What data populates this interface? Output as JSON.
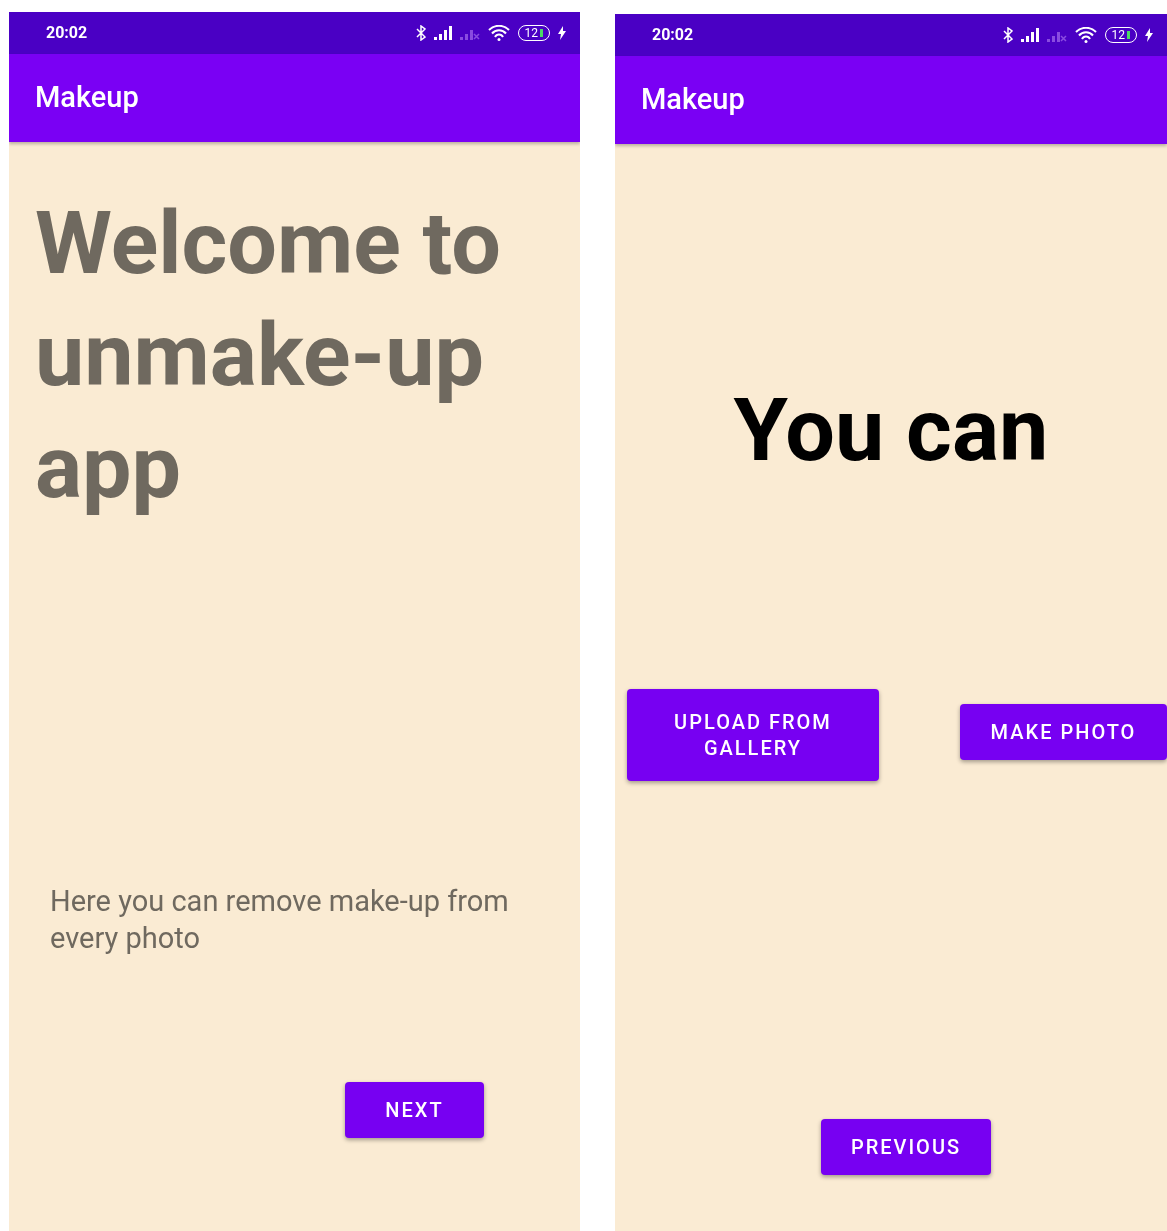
{
  "screens": [
    {
      "kind": "welcome",
      "status_bar": {
        "time": "20:02",
        "battery": "12"
      },
      "app_bar": {
        "title": "Makeup"
      },
      "heading": "Welcome to unmake-up app",
      "description": "Here you can remove make-up from every photo",
      "buttons": [
        "NEXT"
      ]
    },
    {
      "kind": "options",
      "status_bar": {
        "time": "20:02",
        "battery": "12"
      },
      "app_bar": {
        "title": "Makeup"
      },
      "heading": "You can",
      "buttons": [
        "UPLOAD FROM GALLERY",
        "MAKE PHOTO",
        "PREVIOUS"
      ]
    }
  ]
}
